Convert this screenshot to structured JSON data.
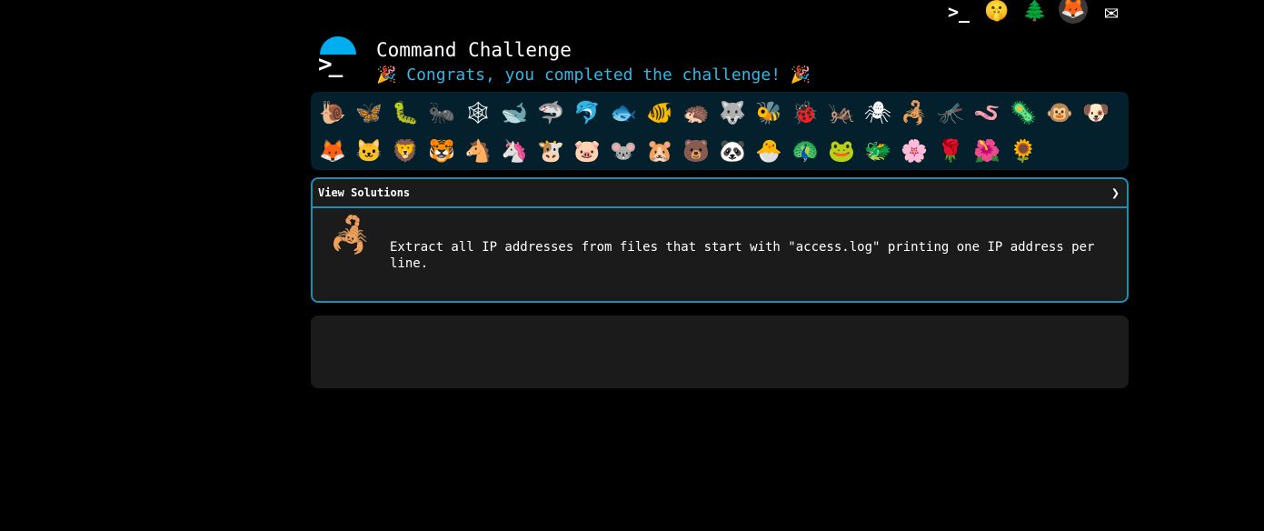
{
  "top_icons": [
    {
      "name": "terminal-icon",
      "glyph": ">_"
    },
    {
      "name": "shush-icon",
      "glyph": "🤫"
    },
    {
      "name": "tree-icon",
      "glyph": "🌲"
    },
    {
      "name": "gitlab-icon",
      "glyph": "🦊"
    },
    {
      "name": "mail-icon",
      "glyph": "✉"
    }
  ],
  "header": {
    "title": "Command Challenge",
    "subtitle": "🎉 Congrats, you completed the challenge! 🎉"
  },
  "animals_row1": [
    "🐌",
    "🦋",
    "🐛",
    "🐜",
    "🕸",
    "🐋",
    "🦈",
    "🐬",
    "🐟",
    "🐠",
    "🦔",
    "🐺",
    "🐝",
    "🐞",
    "🦗",
    "🕷",
    "🦂",
    "🦟",
    "🪱",
    "🦠",
    "🐵",
    "🐶"
  ],
  "animals_row2": [
    "🦊",
    "🐱",
    "🦁",
    "🐯",
    "🐴",
    "🦄",
    "🐮",
    "🐷",
    "🐭",
    "🐹",
    "🐻",
    "🐼",
    "🐣",
    "🦚",
    "🐸",
    "🐲",
    "🌸",
    "🌹",
    "🌺",
    "🌻"
  ],
  "solutions": {
    "label": "View Solutions",
    "chevron": "❯",
    "icon": "🦂",
    "description": "Extract all IP addresses from files that start with \"access.log\" printing one IP address per line."
  },
  "colors": {
    "accent": "#1e8fb4",
    "subtitle": "#2fb8e8",
    "panel": "#1b1b1b",
    "animal_bar": "#03202c"
  }
}
